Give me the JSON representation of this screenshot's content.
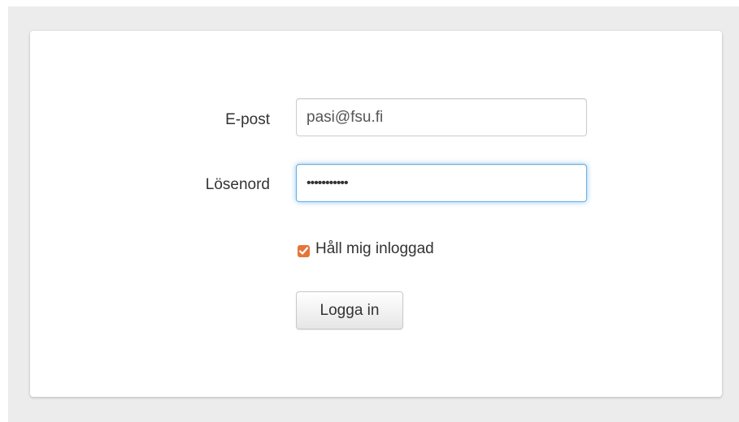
{
  "login_form": {
    "email_label": "E-post",
    "email_value": "pasi@fsu.fi",
    "password_label": "Lösenord",
    "password_value": "•••••••••••",
    "remember_label": "Håll mig inloggad",
    "remember_checked": true,
    "submit_label": "Logga in"
  },
  "colors": {
    "checkbox_accent": "#e6743a",
    "focus_border": "#66afe9",
    "page_background": "#ececec"
  }
}
